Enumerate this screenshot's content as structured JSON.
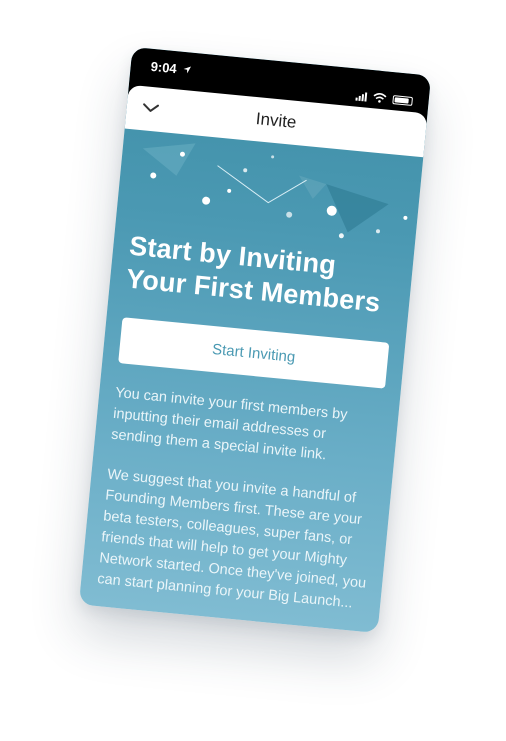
{
  "status_bar": {
    "time": "9:04"
  },
  "nav": {
    "title": "Invite"
  },
  "hero": {
    "headline": "Start by Inviting Your First Members",
    "cta_label": "Start Inviting"
  },
  "body": {
    "paragraph_1": "You can invite your first members by inputting their email addresses or sending them a special invite link.",
    "paragraph_2": "We suggest that you invite a handful of Founding Members first. These are your beta testers, colleagues, super fans, or friends that will help to get your Mighty Network started. Once they've joined, you can start planning for your Big Launch..."
  },
  "colors": {
    "gradient_top": "#3f8fa7",
    "gradient_bottom": "#80bcd2",
    "button_text": "#4b9ab3"
  },
  "icons": [
    "location-arrow-icon",
    "signal-icon",
    "wifi-icon",
    "battery-icon",
    "chevron-down-icon"
  ]
}
